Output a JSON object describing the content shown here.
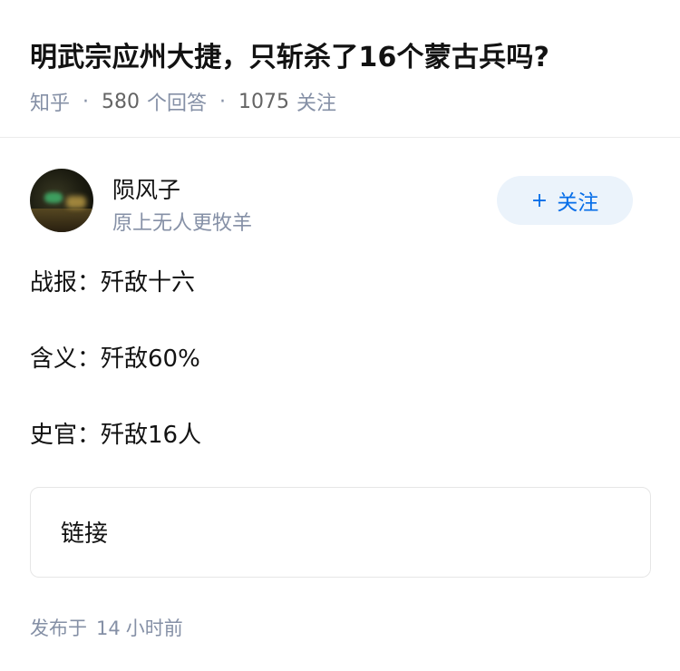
{
  "question": {
    "title": "明武宗应州大捷，只斩杀了16个蒙古兵吗?",
    "source": "知乎",
    "answer_count": "580",
    "answer_label": "个回答",
    "follow_count": "1075",
    "follow_label": "关注",
    "separator": "·"
  },
  "author": {
    "name": "陨风子",
    "headline": "原上无人更牧羊",
    "follow_button": {
      "icon": "plus-icon",
      "plus": "+",
      "label": "关注"
    }
  },
  "answer": {
    "paragraphs": [
      "战报：歼敌十六",
      "含义：歼敌60%",
      "史官：歼敌16人"
    ],
    "link_card_label": "链接",
    "published_prefix": "发布于",
    "published_value": "14",
    "published_suffix": "小时前"
  },
  "colors": {
    "accent": "#056de8",
    "follow_bg": "#ebf3fb",
    "meta_gray": "#8590a6",
    "text": "#121212"
  }
}
